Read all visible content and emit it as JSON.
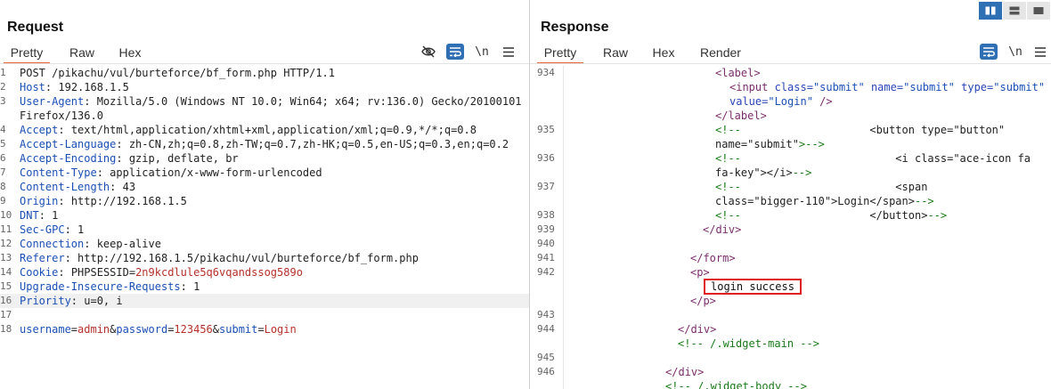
{
  "request": {
    "title": "Request",
    "tabs": [
      "Pretty",
      "Raw",
      "Hex"
    ],
    "tools": {
      "hide": "eye-off-icon",
      "wrap": "word-wrap-icon",
      "newline": "\\n",
      "menu": "menu-icon"
    },
    "lines": [
      {
        "n": "1",
        "k": "",
        "v": "POST /pikachu/vul/burteforce/bf_form.php HTTP/1.1"
      },
      {
        "n": "2",
        "k": "Host",
        "v": " 192.168.1.5"
      },
      {
        "n": "3",
        "k": "User-Agent",
        "v": " Mozilla/5.0 (Windows NT 10.0; Win64; x64; rv:136.0) Gecko/20100101"
      },
      {
        "n": "",
        "k": "",
        "v": "Firefox/136.0"
      },
      {
        "n": "4",
        "k": "Accept",
        "v": " text/html,application/xhtml+xml,application/xml;q=0.9,*/*;q=0.8"
      },
      {
        "n": "5",
        "k": "Accept-Language",
        "v": " zh-CN,zh;q=0.8,zh-TW;q=0.7,zh-HK;q=0.5,en-US;q=0.3,en;q=0.2"
      },
      {
        "n": "6",
        "k": "Accept-Encoding",
        "v": " gzip, deflate, br"
      },
      {
        "n": "7",
        "k": "Content-Type",
        "v": " application/x-www-form-urlencoded"
      },
      {
        "n": "8",
        "k": "Content-Length",
        "v": " 43"
      },
      {
        "n": "9",
        "k": "Origin",
        "v": " http://192.168.1.5"
      },
      {
        "n": "10",
        "k": "DNT",
        "v": " 1"
      },
      {
        "n": "11",
        "k": "Sec-GPC",
        "v": " 1"
      },
      {
        "n": "12",
        "k": "Connection",
        "v": " keep-alive"
      },
      {
        "n": "13",
        "k": "Referer",
        "v": " http://192.168.1.5/pikachu/vul/burteforce/bf_form.php"
      },
      {
        "n": "14",
        "k": "Cookie",
        "v": " PHPSESSID=",
        "v2": "2n9kcdlule5q6vqandssog589o"
      },
      {
        "n": "15",
        "k": "Upgrade-Insecure-Requests",
        "v": " 1"
      },
      {
        "n": "16",
        "k": "Priority",
        "v": " u=0, i"
      },
      {
        "n": "17",
        "k": "",
        "v": ""
      },
      {
        "n": "18",
        "k": "",
        "v": ""
      }
    ],
    "body": {
      "p1": "username",
      "eq1": "=",
      "v1": "admin",
      "amp1": "&",
      "p2": "password",
      "eq2": "=",
      "v2": "123456",
      "amp2": "&",
      "p3": "submit",
      "eq3": "=",
      "v3": "Login"
    }
  },
  "response": {
    "title": "Response",
    "tabs": [
      "Pretty",
      "Raw",
      "Hex",
      "Render"
    ],
    "tools": {
      "wrap": "word-wrap-icon",
      "newline": "\\n",
      "menu": "menu-icon"
    },
    "layout": [
      "split-vertical-icon",
      "split-horizontal-icon",
      "single-pane-icon"
    ],
    "lines": [
      {
        "n": "934",
        "html": [
          [
            "tag",
            "&lt;label&gt;"
          ]
        ]
      },
      {
        "n": "",
        "html": [
          [
            "tag",
            "&lt;input "
          ],
          [
            "attr",
            "class="
          ],
          [
            "aval",
            "\"submit\""
          ],
          [
            "attr",
            " name="
          ],
          [
            "aval",
            "\"submit\""
          ],
          [
            "attr",
            " type="
          ],
          [
            "aval",
            "\"submit\""
          ]
        ]
      },
      {
        "n": "",
        "html": [
          [
            "attr",
            "value="
          ],
          [
            "aval",
            "\"Login\""
          ],
          [
            "tag",
            " /&gt;"
          ]
        ]
      },
      {
        "n": "",
        "html": [
          [
            "tag",
            "&lt;/label&gt;"
          ]
        ]
      },
      {
        "n": "935",
        "html": [
          [
            "cmt",
            "&lt;!--"
          ],
          [
            "cmt",
            "                    "
          ],
          [
            "plain",
            "&lt;button type=\"button\""
          ]
        ]
      },
      {
        "n": "",
        "html": [
          [
            "plain",
            "name=\"submit\""
          ],
          [
            "cmt",
            "&gt;--&gt;"
          ]
        ]
      },
      {
        "n": "936",
        "html": [
          [
            "cmt",
            "&lt;!--"
          ],
          [
            "cmt",
            "                        "
          ],
          [
            "plain",
            "&lt;i class=\"ace-icon fa"
          ]
        ]
      },
      {
        "n": "",
        "html": [
          [
            "plain",
            "fa-key\"&gt;&lt;/i&gt;"
          ],
          [
            "cmt",
            "--&gt;"
          ]
        ]
      },
      {
        "n": "937",
        "html": [
          [
            "cmt",
            "&lt;!--"
          ],
          [
            "cmt",
            "                        "
          ],
          [
            "plain",
            "&lt;span"
          ]
        ]
      },
      {
        "n": "",
        "html": [
          [
            "plain",
            "class=\"bigger-110\"&gt;Login&lt;/span&gt;"
          ],
          [
            "cmt",
            "--&gt;"
          ]
        ]
      },
      {
        "n": "938",
        "html": [
          [
            "cmt",
            "&lt;!--"
          ],
          [
            "cmt",
            "                    "
          ],
          [
            "plain",
            "&lt;/button&gt;"
          ],
          [
            "cmt",
            "--&gt;"
          ]
        ]
      },
      {
        "n": "939",
        "html": [
          [
            "tag",
            "&lt;/div&gt;"
          ]
        ]
      },
      {
        "n": "940",
        "html": []
      },
      {
        "n": "941",
        "html": [
          [
            "tag",
            "&lt;/form&gt;"
          ]
        ]
      },
      {
        "n": "942",
        "html": [
          [
            "tag",
            "&lt;p&gt;"
          ]
        ]
      },
      {
        "n": "",
        "html": []
      },
      {
        "n": "",
        "html": [
          [
            "tag",
            "&lt;/p&gt;"
          ]
        ]
      },
      {
        "n": "943",
        "html": []
      },
      {
        "n": "944",
        "html": [
          [
            "tag",
            "&lt;/div&gt;"
          ]
        ]
      },
      {
        "n": "",
        "html": [
          [
            "cmt",
            "&lt;!-- /.widget-main --&gt;"
          ]
        ]
      },
      {
        "n": "945",
        "html": []
      },
      {
        "n": "946",
        "html": [
          [
            "tag",
            "&lt;/div&gt;"
          ]
        ]
      },
      {
        "n": "",
        "html": [
          [
            "cmt",
            "&lt;!-- /.widget-body --&gt;"
          ]
        ]
      }
    ],
    "success_text": "login success"
  }
}
